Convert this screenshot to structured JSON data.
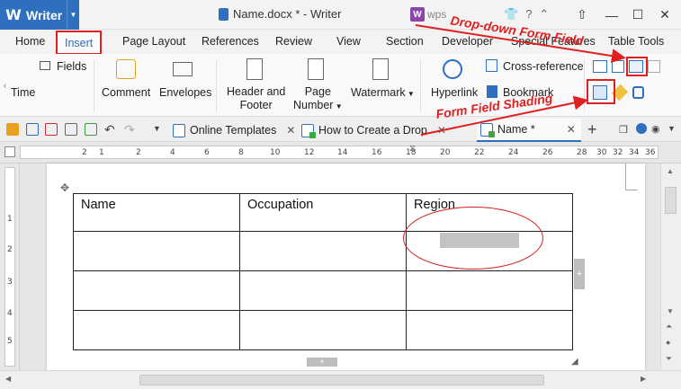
{
  "app": {
    "name": "Writer",
    "doc_title": "Name.docx * - Writer",
    "wps_label": "wps"
  },
  "tabs": [
    "Home",
    "Insert",
    "Page Layout",
    "References",
    "Review",
    "View",
    "Section",
    "Developer",
    "Special Features",
    "Table Tools"
  ],
  "ribbon": {
    "fields": "Fields",
    "time": "Time",
    "comment": "Comment",
    "envelopes": "Envelopes",
    "header_footer": [
      "Header and",
      "Footer"
    ],
    "page_number": [
      "Page",
      "Number"
    ],
    "watermark": "Watermark",
    "hyperlink": "Hyperlink",
    "cross_reference": "Cross-reference",
    "bookmark": "Bookmark"
  },
  "doc_tabs": [
    {
      "label": "Online Templates"
    },
    {
      "label": "How to Create a Drop"
    },
    {
      "label": "Name *"
    }
  ],
  "ruler": {
    "h_ticks": [
      "2",
      "1",
      "2",
      "4",
      "6",
      "8",
      "10",
      "12",
      "14",
      "16",
      "18",
      "20",
      "22",
      "24",
      "26",
      "28",
      "30",
      "32",
      "34",
      "36"
    ],
    "v_ticks": [
      "1",
      "2",
      "3",
      "4",
      "5"
    ]
  },
  "table": {
    "headers": [
      "Name",
      "Occupation",
      "Region"
    ],
    "rows": [
      [
        "",
        "",
        ""
      ],
      [
        "",
        "",
        ""
      ],
      [
        "",
        "",
        ""
      ]
    ]
  },
  "annotations": {
    "dropdown": "Drop-down Form Field",
    "shading": "Form Field Shading"
  },
  "colors": {
    "accent": "#2f6fbf",
    "annotation": "#e02020"
  }
}
